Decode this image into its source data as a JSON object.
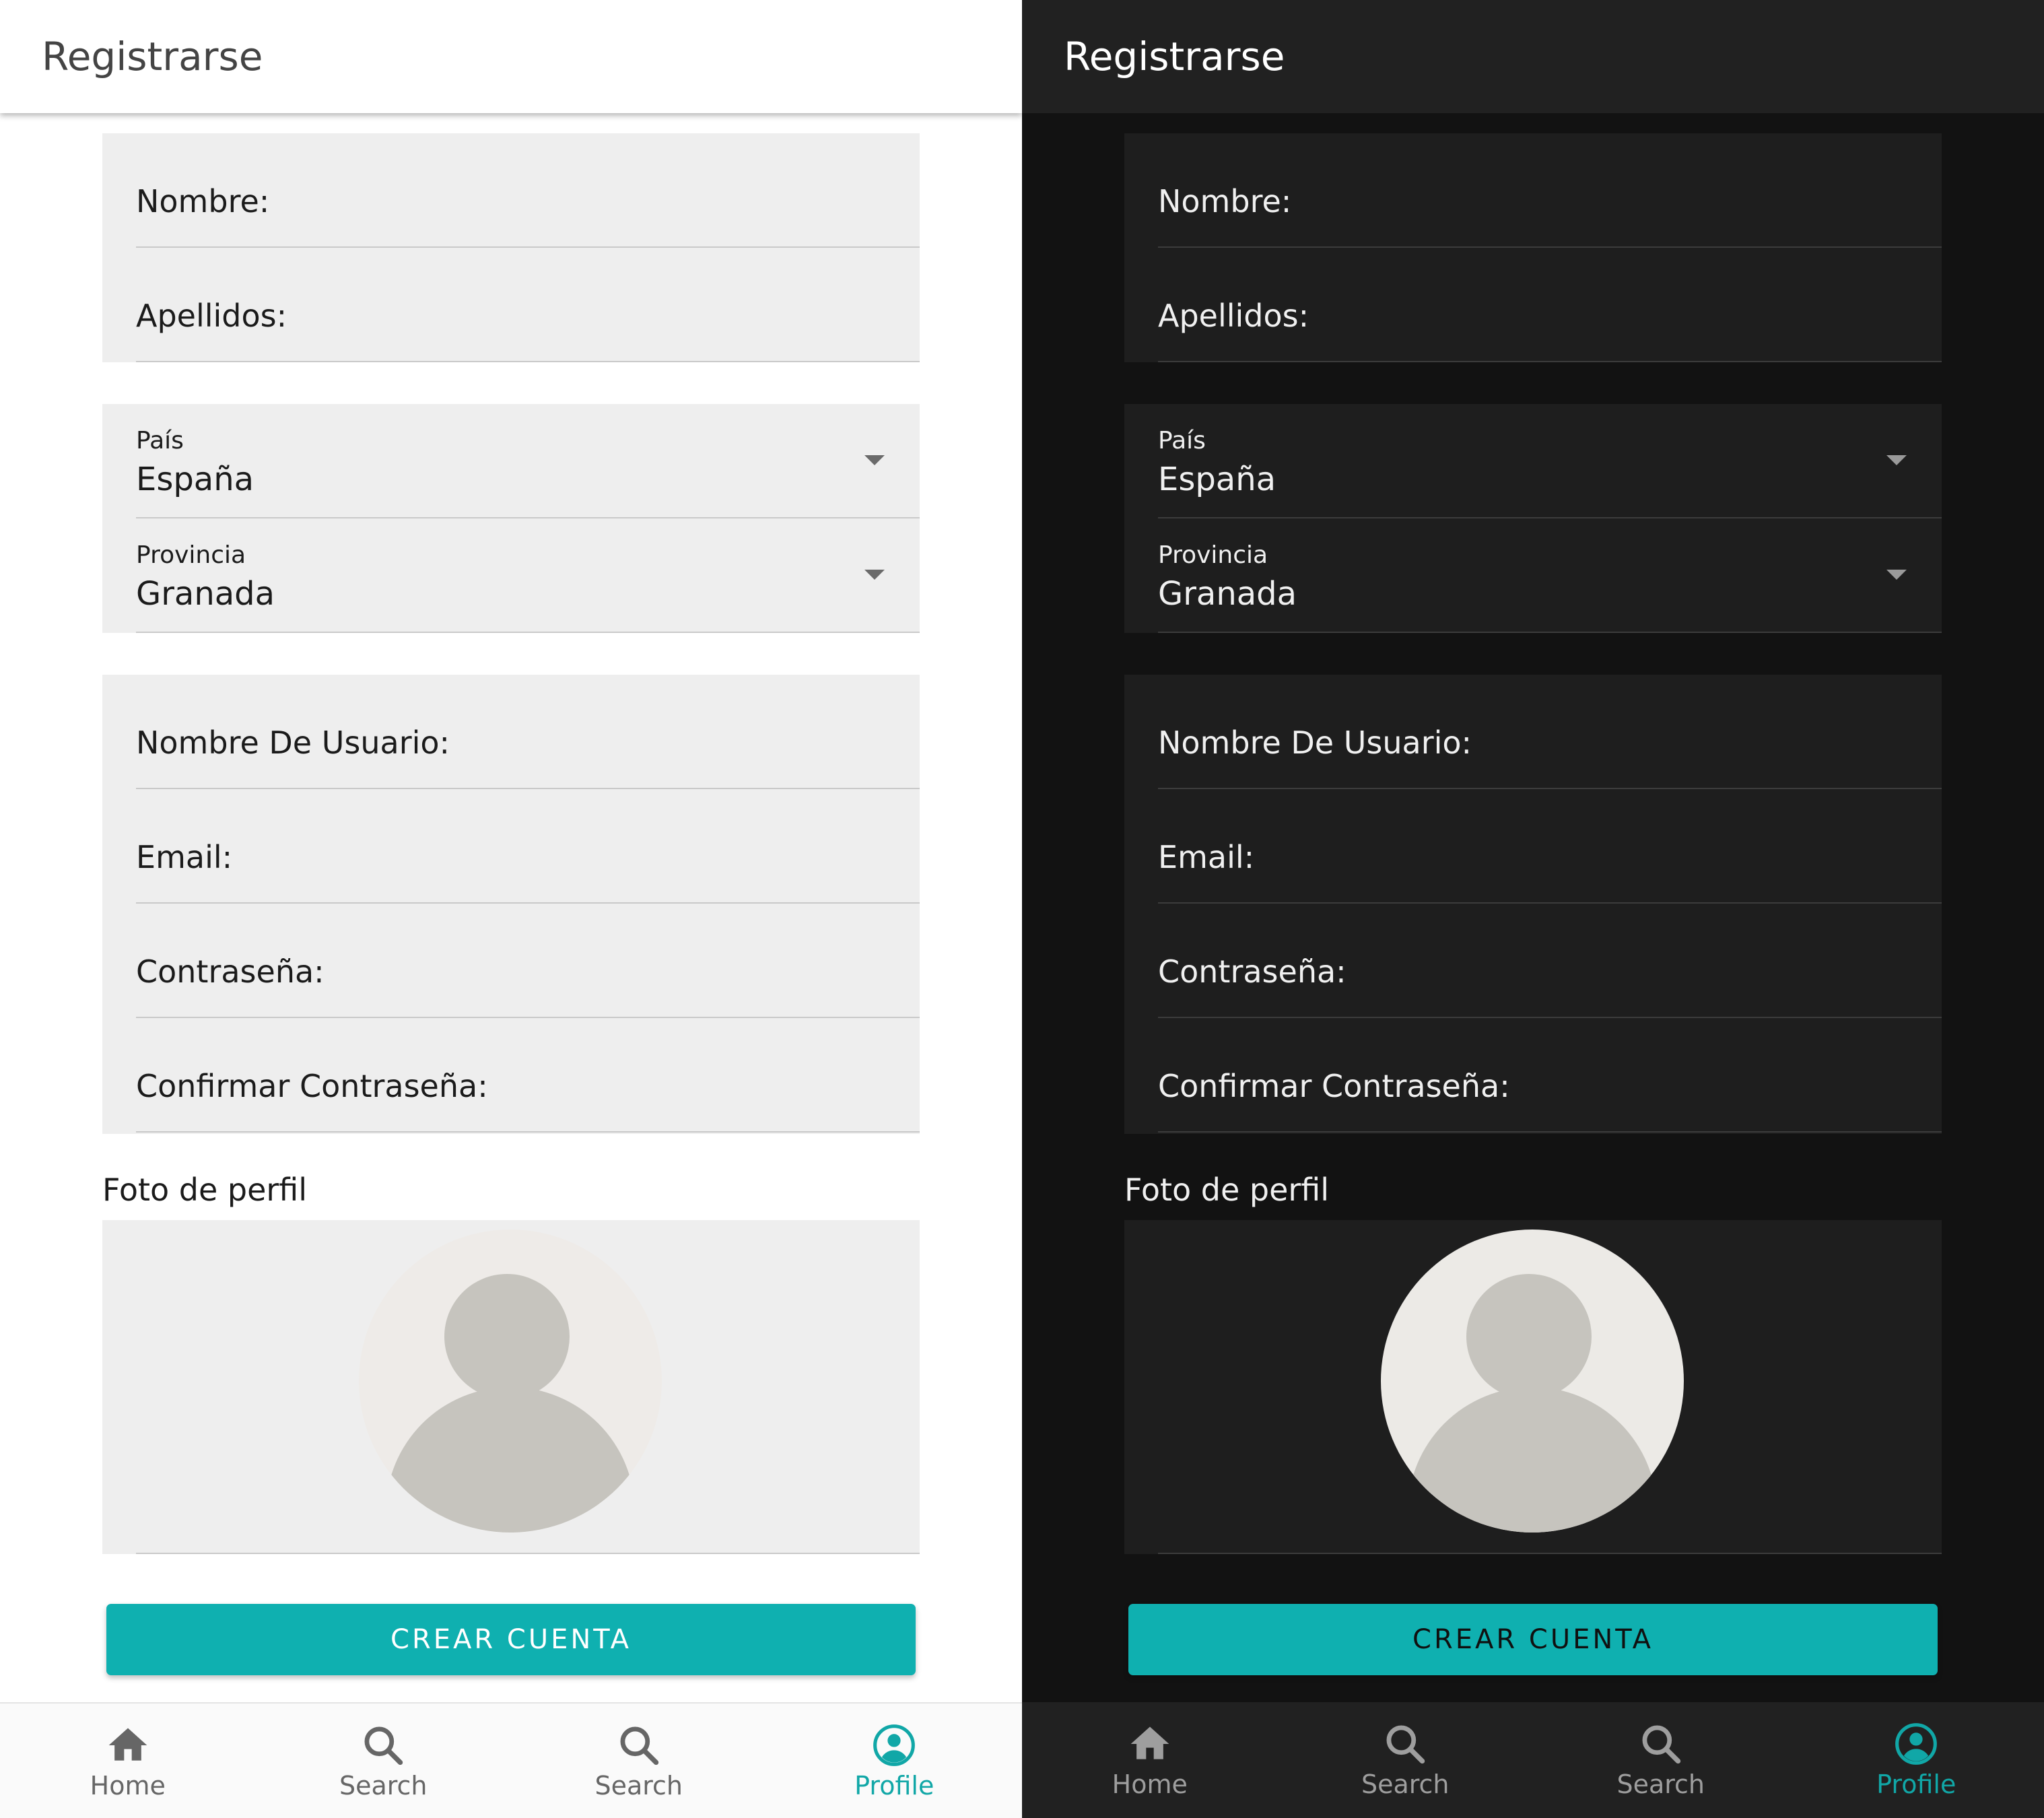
{
  "appbar": {
    "title": "Registrarse"
  },
  "form": {
    "nombre_label": "Nombre:",
    "apellidos_label": "Apellidos:",
    "pais": {
      "label": "País",
      "value": "España"
    },
    "provincia": {
      "label": "Provincia",
      "value": "Granada"
    },
    "usuario_label": "Nombre De Usuario:",
    "email_label": "Email:",
    "password_label": "Contraseña:",
    "confirm_label": "Confirmar Contraseña:",
    "photo_label": "Foto de perfil",
    "submit_label": "CREAR CUENTA"
  },
  "nav": {
    "items": [
      {
        "label": "Home",
        "icon": "home-icon"
      },
      {
        "label": "Search",
        "icon": "search-icon"
      },
      {
        "label": "Search",
        "icon": "search-icon"
      },
      {
        "label": "Profile",
        "icon": "profile-icon",
        "active": true
      }
    ]
  },
  "colors": {
    "accent": "#0fb0b0",
    "light_background": "#ffffff",
    "dark_background": "#121212",
    "light_field": "#eeeeee",
    "dark_field": "#1e1e1e"
  }
}
